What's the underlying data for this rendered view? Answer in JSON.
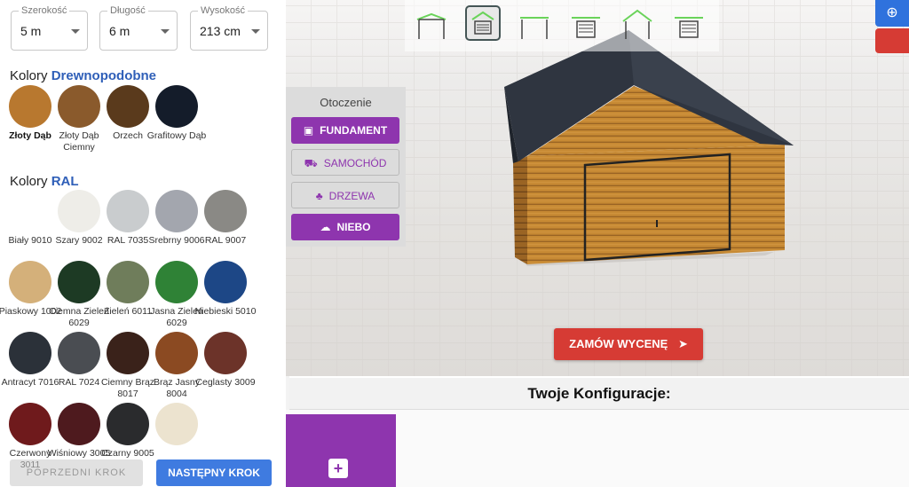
{
  "dimensions": [
    {
      "label": "Szerokość",
      "value": "5 m"
    },
    {
      "label": "Długość",
      "value": "6 m"
    },
    {
      "label": "Wysokość",
      "value": "213 cm"
    }
  ],
  "wood_section": {
    "prefix": "Kolory",
    "accent": "Drewnopodobne"
  },
  "wood_colors": [
    {
      "name": "Złoty Dąb",
      "color": "#b8782f",
      "selected": true
    },
    {
      "name": "Złoty Dąb Ciemny",
      "color": "#8a5a2c"
    },
    {
      "name": "Orzech",
      "color": "#5a3a1c"
    },
    {
      "name": "Grafitowy Dąb",
      "color": "#141c2a"
    }
  ],
  "ral_section": {
    "prefix": "Kolory",
    "accent": "RAL"
  },
  "ral_colors": [
    {
      "name": "Biały 9010",
      "color": "#ffffff"
    },
    {
      "name": "Szary 9002",
      "color": "#eeede8"
    },
    {
      "name": "RAL 7035",
      "color": "#c9ccce"
    },
    {
      "name": "Srebrny 9006",
      "color": "#a3a6ae"
    },
    {
      "name": "RAL 9007",
      "color": "#8a8985"
    },
    {
      "name": "Piaskowy 1002",
      "color": "#d4b07a"
    },
    {
      "name": "Ciemna Zieleń 6029",
      "color": "#1d3a24"
    },
    {
      "name": "Zieleń 6011",
      "color": "#6f7d5b"
    },
    {
      "name": "Jasna Zieleń 6029",
      "color": "#2f8236"
    },
    {
      "name": "Niebieski 5010",
      "color": "#1d4786"
    },
    {
      "name": "Antracyt 7016",
      "color": "#2b3139"
    },
    {
      "name": "RAL 7024",
      "color": "#4a4d52"
    },
    {
      "name": "Ciemny Brąz 8017",
      "color": "#3a221a"
    },
    {
      "name": "Brąz Jasny 8004",
      "color": "#8b4a22"
    },
    {
      "name": "Ceglasty 3009",
      "color": "#6c3329"
    },
    {
      "name": "Czerwony 3011",
      "color": "#6f1a1c"
    },
    {
      "name": "Wiśniowy 3005",
      "color": "#4e1a1e"
    },
    {
      "name": "Czarny 9005",
      "color": "#2a2b2d"
    },
    {
      "name": "",
      "color": "#ece3cf"
    }
  ],
  "prev_button": "POPRZEDNI KROK",
  "next_button": "NASTĘPNY KROK",
  "otoczenie": {
    "title": "Otoczenie",
    "buttons": [
      {
        "label": "FUNDAMENT",
        "on": true,
        "icon": "foundation-icon"
      },
      {
        "label": "SAMOCHÓD",
        "on": false,
        "icon": "car-icon"
      },
      {
        "label": "DRZEWA",
        "on": false,
        "icon": "tree-icon"
      },
      {
        "label": "NIEBO",
        "on": true,
        "icon": "cloud-icon"
      }
    ]
  },
  "view_buttons": [
    "view-1-icon",
    "view-2-icon",
    "view-3-icon",
    "view-4-icon",
    "view-5-icon",
    "view-6-icon"
  ],
  "zamow_button": "ZAMÓW WYCENĘ",
  "konfiguracje_title": "Twoje Konfiguracje:",
  "colors": {
    "purple": "#8e35ae",
    "red": "#d63b34",
    "blue": "#3f7be0"
  }
}
